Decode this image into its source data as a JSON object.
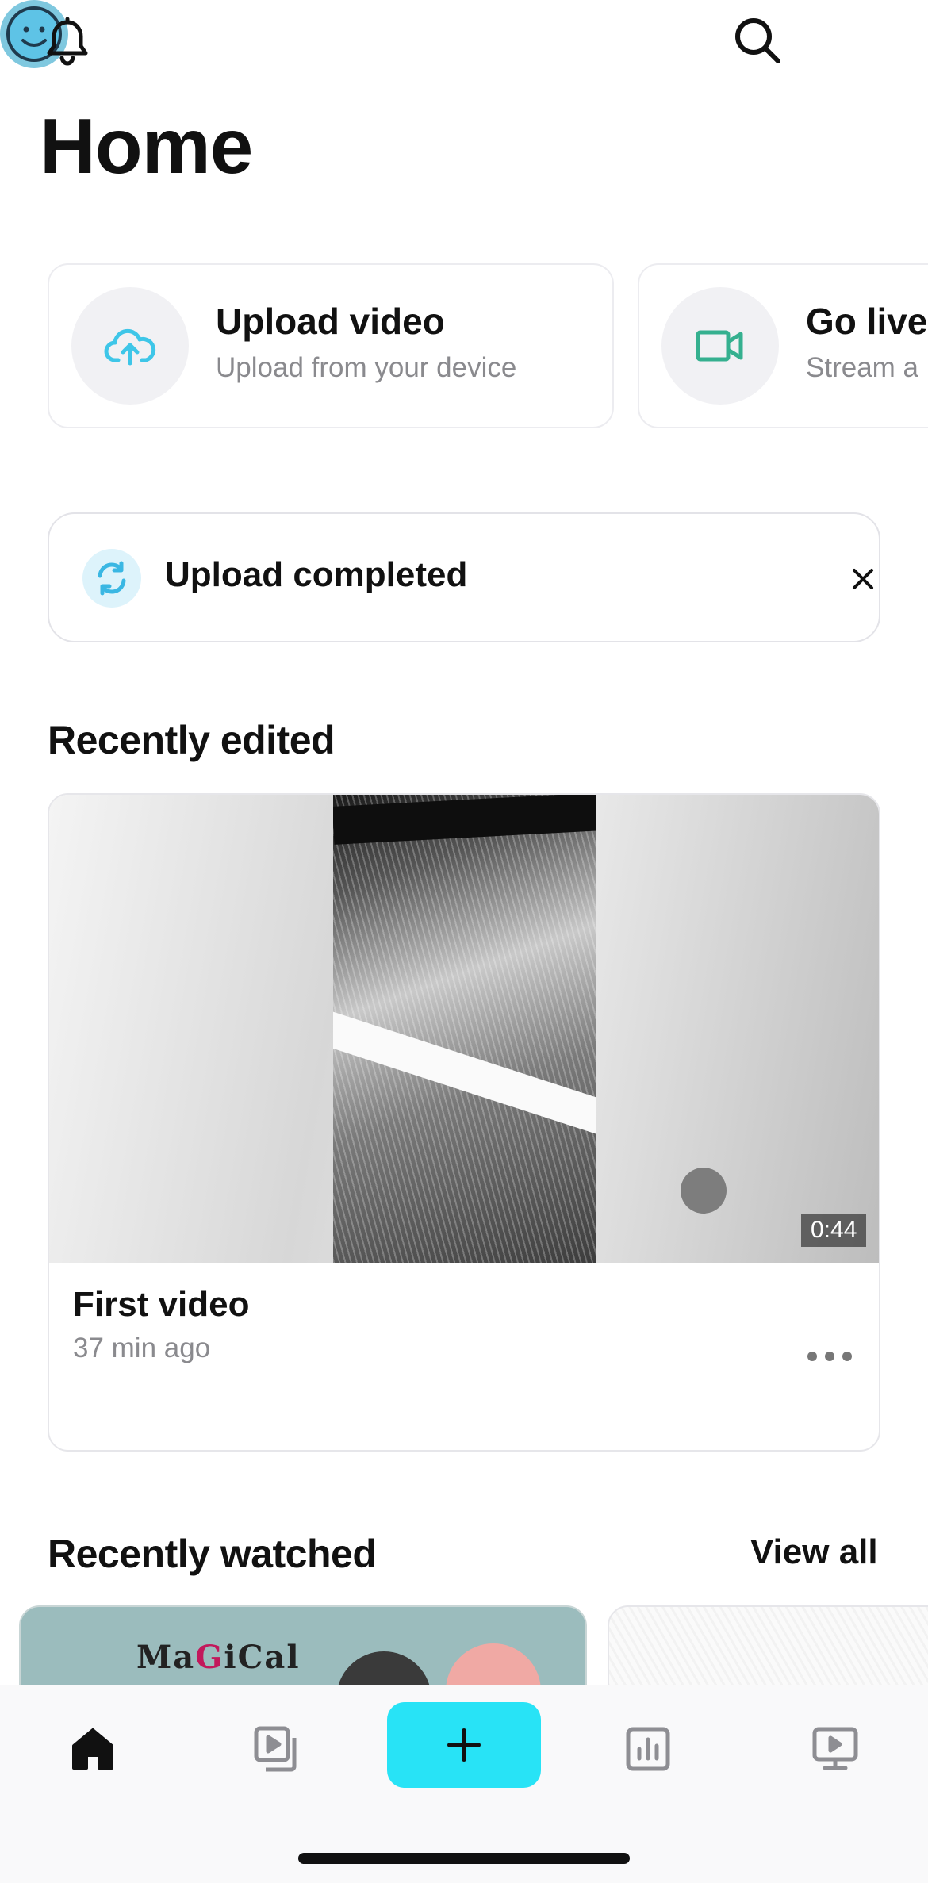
{
  "header": {
    "icons": [
      "bell-icon",
      "search-icon",
      "avatar"
    ],
    "title": "Home"
  },
  "actions": [
    {
      "title": "Upload video",
      "subtitle": "Upload from your device",
      "icon": "cloud-upload-icon",
      "icon_color": "#3ec6e8"
    },
    {
      "title": "Go live",
      "subtitle": "Stream a",
      "icon": "video-camera-icon",
      "icon_color": "#35b08f"
    }
  ],
  "banner": {
    "text": "Upload completed",
    "icon": "sync-icon",
    "close_icon": "close-icon"
  },
  "recently_edited": {
    "title": "Recently edited",
    "items": [
      {
        "title": "First video",
        "time": "37 min ago",
        "duration": "0:44"
      }
    ]
  },
  "recently_watched": {
    "title": "Recently watched",
    "view_all": "View all",
    "items": [
      {
        "thumb_text_parts": [
          "Ma",
          "G",
          "i",
          "Cal"
        ]
      }
    ]
  },
  "bottom_nav": {
    "items": [
      "home-icon",
      "library-icon",
      "plus-icon",
      "stats-icon",
      "channel-icon"
    ],
    "accent": "#28e3f6"
  }
}
